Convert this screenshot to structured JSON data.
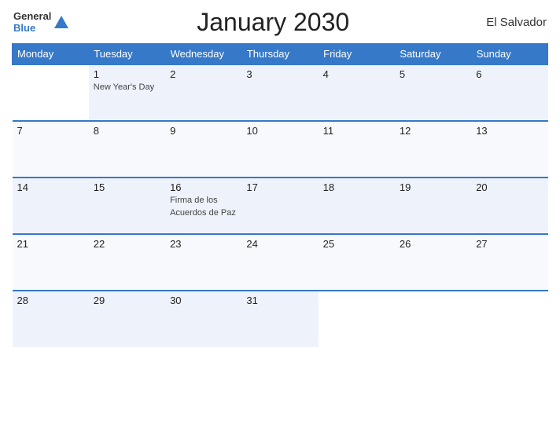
{
  "header": {
    "logo_general": "General",
    "logo_blue": "Blue",
    "title": "January 2030",
    "country": "El Salvador"
  },
  "weekdays": [
    "Monday",
    "Tuesday",
    "Wednesday",
    "Thursday",
    "Friday",
    "Saturday",
    "Sunday"
  ],
  "weeks": [
    [
      {
        "day": "",
        "holiday": ""
      },
      {
        "day": "1",
        "holiday": "New Year's Day"
      },
      {
        "day": "2",
        "holiday": ""
      },
      {
        "day": "3",
        "holiday": ""
      },
      {
        "day": "4",
        "holiday": ""
      },
      {
        "day": "5",
        "holiday": ""
      },
      {
        "day": "6",
        "holiday": ""
      }
    ],
    [
      {
        "day": "7",
        "holiday": ""
      },
      {
        "day": "8",
        "holiday": ""
      },
      {
        "day": "9",
        "holiday": ""
      },
      {
        "day": "10",
        "holiday": ""
      },
      {
        "day": "11",
        "holiday": ""
      },
      {
        "day": "12",
        "holiday": ""
      },
      {
        "day": "13",
        "holiday": ""
      }
    ],
    [
      {
        "day": "14",
        "holiday": ""
      },
      {
        "day": "15",
        "holiday": ""
      },
      {
        "day": "16",
        "holiday": "Firma de los Acuerdos de Paz"
      },
      {
        "day": "17",
        "holiday": ""
      },
      {
        "day": "18",
        "holiday": ""
      },
      {
        "day": "19",
        "holiday": ""
      },
      {
        "day": "20",
        "holiday": ""
      }
    ],
    [
      {
        "day": "21",
        "holiday": ""
      },
      {
        "day": "22",
        "holiday": ""
      },
      {
        "day": "23",
        "holiday": ""
      },
      {
        "day": "24",
        "holiday": ""
      },
      {
        "day": "25",
        "holiday": ""
      },
      {
        "day": "26",
        "holiday": ""
      },
      {
        "day": "27",
        "holiday": ""
      }
    ],
    [
      {
        "day": "28",
        "holiday": ""
      },
      {
        "day": "29",
        "holiday": ""
      },
      {
        "day": "30",
        "holiday": ""
      },
      {
        "day": "31",
        "holiday": ""
      },
      {
        "day": "",
        "holiday": ""
      },
      {
        "day": "",
        "holiday": ""
      },
      {
        "day": "",
        "holiday": ""
      }
    ]
  ]
}
